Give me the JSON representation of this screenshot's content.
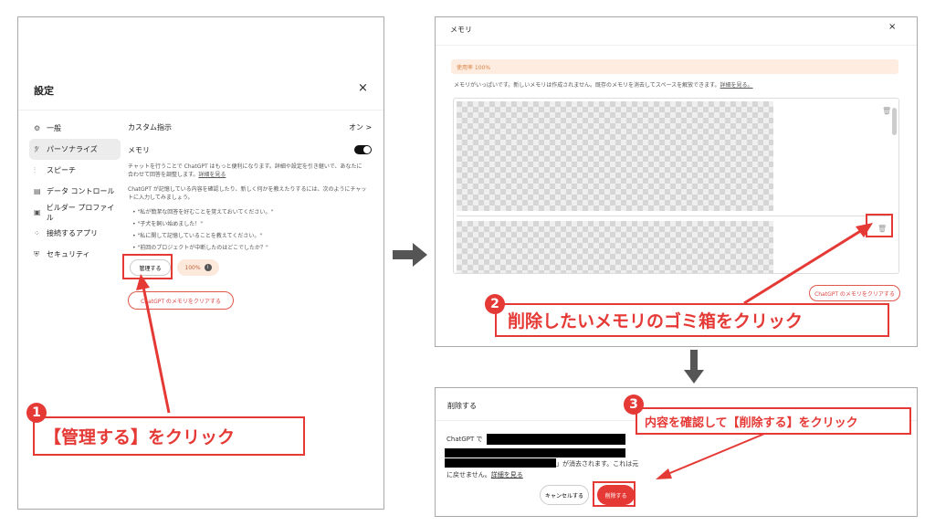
{
  "settings": {
    "title": "設定",
    "close_glyph": "×",
    "sidebar": [
      {
        "label": "一般",
        "icon": "gear-icon",
        "glyph": "⚙"
      },
      {
        "label": "パーソナライズ",
        "icon": "person-icon",
        "glyph": "ꐕ"
      },
      {
        "label": "スピーチ",
        "icon": "waveform-icon",
        "glyph": "⫶"
      },
      {
        "label": "データ コントロール",
        "icon": "database-icon",
        "glyph": "▤"
      },
      {
        "label": "ビルダー プロファイル",
        "icon": "profile-card-icon",
        "glyph": "▣"
      },
      {
        "label": "接続するアプリ",
        "icon": "apps-grid-icon",
        "glyph": "⁘"
      },
      {
        "label": "セキュリティ",
        "icon": "shield-icon",
        "glyph": "⛨"
      }
    ],
    "custom_instructions": {
      "label": "カスタム指示",
      "value": "オン >"
    },
    "memory": {
      "label": "メモリ",
      "desc1": "チャットを行うことで ChatGPT はもっと便利になります。詳細や設定を引き継いで、あなたに合わせて回答を調整します。",
      "desc1_link": "詳細を見る",
      "desc2": "ChatGPT が記憶している内容を確認したり、新しく何かを教えたりするには、次のようにチャットに入力してみましょう。",
      "examples": [
        "\"私が簡潔な回答を好むことを覚えておいてください。\"",
        "\"子犬を飼い始めました！\"",
        "\"私に関して記憶していることを教えてください。\"",
        "\"前回のプロジェクトが中断したのはどこでしたか？\""
      ],
      "manage_button": "管理する",
      "usage": "100%",
      "clear_button": "ChatGPT のメモリをクリアする"
    }
  },
  "callouts": {
    "step1_num": "1",
    "step1_text": "【管理する】をクリック",
    "step2_num": "2",
    "step2_text": "削除したいメモリのゴミ箱をクリック",
    "step3_num": "3",
    "step3_text": "内容を確認して【削除する】をクリック"
  },
  "memory_dialog": {
    "title": "メモリ",
    "close_glyph": "×",
    "usage_label": "使用率 100%",
    "note": "メモリがいっぱいです。新しいメモリは作成されません。既存のメモリを消去してスペースを解放できます。",
    "note_link": "詳細を見る。",
    "clear_button": "ChatGPT のメモリをクリアする",
    "trash_glyph": "🗑"
  },
  "delete_dialog": {
    "title": "削除する",
    "line1_prefix": "ChatGPT で「",
    "line2_suffix": "」が消去されます。これは元",
    "line3": "に戻せません。",
    "link": "詳細を見る",
    "cancel_button": "キャンセルする",
    "delete_button": "削除する"
  },
  "colors": {
    "accent": "#e53935",
    "warn_bg": "#fdecdf",
    "arrow": "#555555"
  }
}
